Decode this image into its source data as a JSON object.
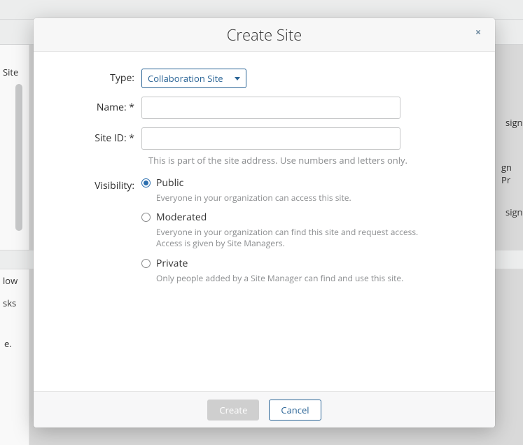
{
  "background": {
    "site": "Site",
    "sign": "sign",
    "gn_pr": "gn Pr",
    "sign2": "sign",
    "low": "low",
    "sks": "sks",
    "e": "e."
  },
  "dialog": {
    "title": "Create Site",
    "close": "×",
    "type_label": "Type:",
    "type_value": "Collaboration Site",
    "name_label": "Name:",
    "name_req": "*",
    "siteid_label": "Site ID:",
    "siteid_req": "*",
    "siteid_help": "This is part of the site address. Use numbers and letters only.",
    "visibility_label": "Visibility:",
    "visibility": {
      "public": {
        "label": "Public",
        "desc": "Everyone in your organization can access this site."
      },
      "moderated": {
        "label": "Moderated",
        "desc": "Everyone in your organization can find this site and request access. Access is given by Site Managers."
      },
      "private": {
        "label": "Private",
        "desc": "Only people added by a Site Manager can find and use this site."
      }
    },
    "create_btn": "Create",
    "cancel_btn": "Cancel"
  }
}
